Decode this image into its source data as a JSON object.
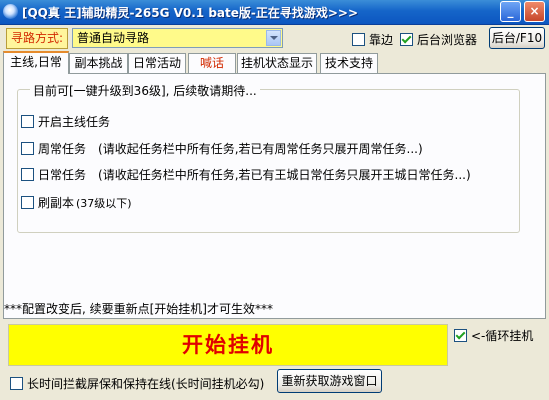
{
  "window": {
    "title": "[QQ真 王]辅助精灵-265G V0.1 bate版-正在寻找游戏>>>",
    "minimize": "_",
    "close": "×"
  },
  "toolbar": {
    "pathfinding_label": "寻路方式:",
    "pathfinding_value": "普通自动寻路",
    "edge_label": "靠边",
    "edge_checked": false,
    "background_browser_label": "后台浏览器",
    "background_browser_checked": true,
    "background_button": "后台/F10"
  },
  "tabs": [
    {
      "label": "主线,日常",
      "active": true
    },
    {
      "label": "副本挑战",
      "active": false
    },
    {
      "label": "日常活动",
      "active": false
    },
    {
      "label": "喊话",
      "active": false,
      "color": "#d22a00"
    },
    {
      "label": "挂机状态显示",
      "active": false
    },
    {
      "label": "技术支持",
      "active": false
    }
  ],
  "panel": {
    "group_title": "目前可[一键升级到36级], 后续敬请期待...",
    "options": [
      {
        "label": "开启主线任务",
        "checked": false
      },
      {
        "label": "周常任务",
        "desc": "(请收起任务栏中所有任务,若已有周常任务只展开周常任务...)",
        "checked": false
      },
      {
        "label": "日常任务",
        "desc": "(请收起任务栏中所有任务,若已有王城日常任务只展开王城日常任务...)",
        "checked": false
      },
      {
        "label": "刷副本",
        "desc": "(37级以下)",
        "checked": false
      }
    ],
    "note": "***配置改变后, 续要重新点[开始挂机]才可生效***"
  },
  "controls": {
    "start_button": "开始挂机",
    "loop_label": "<-循环挂机",
    "loop_checked": true,
    "anti_lock_label": "长时间拦截屏保和保持在线(长时间挂机必勾)",
    "anti_lock_checked": false,
    "reacquire_button": "重新获取游戏窗口"
  },
  "colors": {
    "title_bar": "#1565c9",
    "start_button_bg": "#ffff00",
    "start_button_text": "#e00000",
    "combo_bg": "#fffa8a",
    "accent_red": "#d22a00"
  }
}
